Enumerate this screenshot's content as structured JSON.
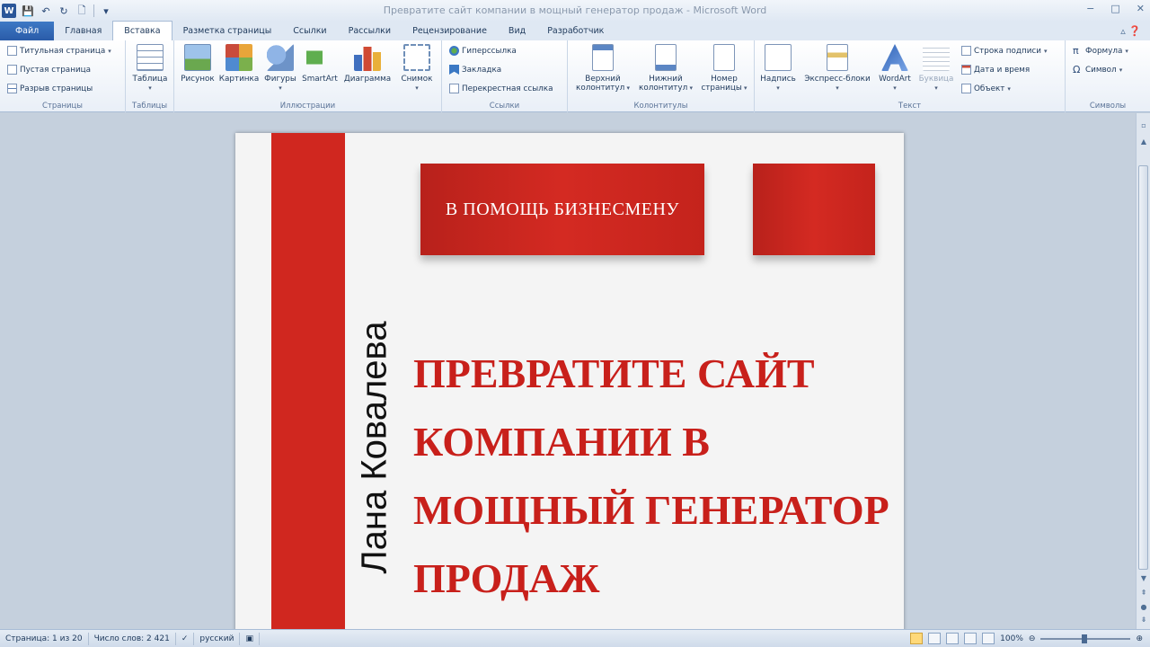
{
  "window": {
    "title": "Превратите сайт компании в мощный генератор продаж  -  Microsoft Word",
    "logo": "W",
    "controls": [
      "−",
      "□",
      "✕"
    ]
  },
  "quick_access": {
    "icons": [
      "save-icon",
      "undo-icon",
      "redo-icon",
      "new-icon",
      "customize-icon"
    ],
    "glyphs": [
      "💾",
      "↶",
      "↻",
      "🗋",
      "▾"
    ]
  },
  "tabs": [
    {
      "label": "Файл"
    },
    {
      "label": "Главная"
    },
    {
      "label": "Вставка"
    },
    {
      "label": "Разметка страницы"
    },
    {
      "label": "Ссылки"
    },
    {
      "label": "Рассылки"
    },
    {
      "label": "Рецензирование"
    },
    {
      "label": "Вид"
    },
    {
      "label": "Разработчик"
    }
  ],
  "active_tab": "Вставка",
  "ribbon": {
    "pages": {
      "label": "Страницы",
      "items": [
        "Титульная страница",
        "Пустая страница",
        "Разрыв страницы"
      ]
    },
    "tables": {
      "label": "Таблицы",
      "table": "Таблица"
    },
    "illustrations": {
      "label": "Иллюстрации",
      "items": [
        "Рисунок",
        "Картинка",
        "Фигуры",
        "SmartArt",
        "Диаграмма",
        "Снимок"
      ]
    },
    "links": {
      "label": "Ссылки",
      "items": [
        "Гиперссылка",
        "Закладка",
        "Перекрестная ссылка"
      ]
    },
    "header_footer": {
      "label": "Колонтитулы",
      "header": [
        "Верхний",
        "колонтитул"
      ],
      "footer": [
        "Нижний",
        "колонтитул"
      ],
      "page_number": [
        "Номер",
        "страницы"
      ]
    },
    "text": {
      "label": "Текст",
      "textbox": "Надпись",
      "quickparts": "Экспресс-блоки",
      "wordart": "WordArt",
      "dropcap": "Буквица",
      "signature": "Строка подписи",
      "datetime": "Дата и время",
      "object": "Объект"
    },
    "symbols": {
      "label": "Символы",
      "formula": "Формула",
      "symbol": "Символ"
    }
  },
  "document": {
    "banner": "В ПОМОЩЬ БИЗНЕСМЕНУ",
    "author": "Лана Ковалева",
    "headline": [
      "ПРЕВРАТИТЕ САЙТ",
      "КОМПАНИИ В",
      "МОЩНЫЙ ГЕНЕРАТОР",
      "ПРОДАЖ"
    ],
    "accent": "#d0271f"
  },
  "statusbar": {
    "page": "Страница: 1 из 20",
    "words": "Число слов: 2 421",
    "language": "русский",
    "zoom": "100%"
  }
}
